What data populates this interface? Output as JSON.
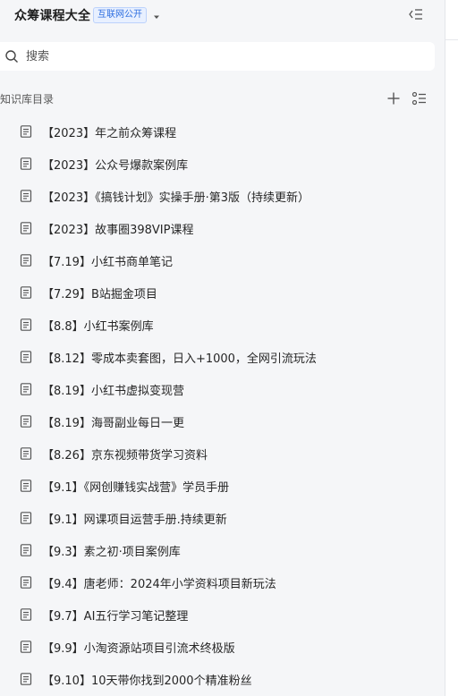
{
  "header": {
    "title": "众筹课程大全",
    "badge": "互联网公开"
  },
  "search": {
    "placeholder": "搜索",
    "value": ""
  },
  "section": {
    "label": "知识库目录"
  },
  "items": [
    {
      "label": "【2023】年之前众筹课程"
    },
    {
      "label": "【2023】公众号爆款案例库"
    },
    {
      "label": "【2023】《搞钱计划》实操手册·第3版（持续更新）"
    },
    {
      "label": "【2023】故事圈398VIP课程"
    },
    {
      "label": "【7.19】小红书商单笔记"
    },
    {
      "label": "【7.29】B站掘金项目"
    },
    {
      "label": "【8.8】小红书案例库"
    },
    {
      "label": "【8.12】零成本卖套图，日入+1000，全网引流玩法"
    },
    {
      "label": "【8.19】小红书虚拟变现营"
    },
    {
      "label": "【8.19】海哥副业每日一更"
    },
    {
      "label": "【8.26】京东视频带货学习资料"
    },
    {
      "label": "【9.1】《网创赚钱实战营》学员手册"
    },
    {
      "label": "【9.1】网课项目运营手册.持续更新"
    },
    {
      "label": "【9.3】素之初·项目案例库"
    },
    {
      "label": "【9.4】唐老师：2024年小学资料项目新玩法"
    },
    {
      "label": "【9.7】AI五行学习笔记整理"
    },
    {
      "label": "【9.9】小淘资源站项目引流术终极版"
    },
    {
      "label": "【9.10】10天带你找到2000个精准粉丝"
    }
  ]
}
